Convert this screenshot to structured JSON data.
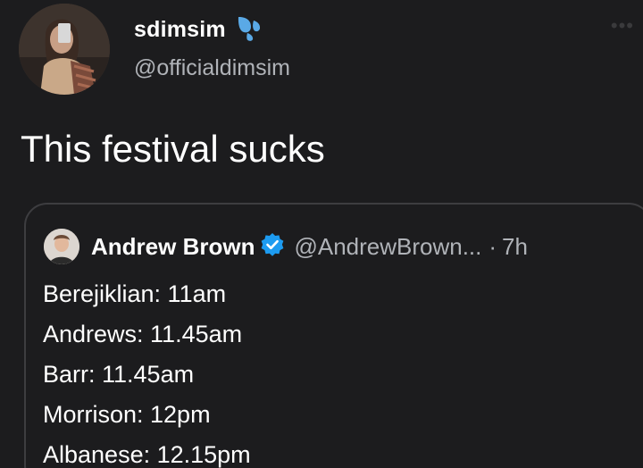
{
  "tweet": {
    "author": {
      "display_name": "sdimsim",
      "handle": "@officialdimsim",
      "badge_icon": "sweat-droplets-icon"
    },
    "text": "This festival sucks",
    "more_icon": "more-horizontal-icon",
    "quoted": {
      "author": {
        "display_name": "Andrew Brown",
        "handle": "@AndrewBrown...",
        "verified_icon": "verified-badge-icon"
      },
      "separator": "·",
      "time": "7h",
      "lines": [
        "Berejiklian: 11am",
        "Andrews: 11.45am",
        "Barr: 11.45am",
        "Morrison: 12pm",
        "Albanese: 12.15pm"
      ]
    }
  },
  "colors": {
    "background": "#1c1c1e",
    "primary_text": "#ffffff",
    "secondary_text": "#b0b3b8",
    "border": "#3d3d40",
    "accent_blue": "#1d9bf0"
  }
}
